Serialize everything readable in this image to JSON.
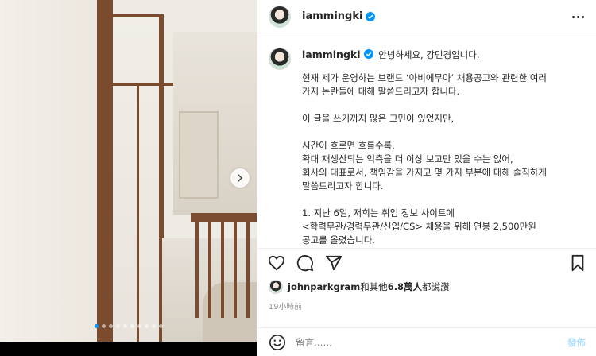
{
  "post": {
    "username": "iammingki",
    "greeting": "안녕하세요, 강민경입니다.",
    "caption_paragraphs": [
      "현재 제가 운영하는 브랜드 ‘아비에무아’ 채용공고와 관련한 여러\n가지 논란들에 대해 말씀드리고자 합니다.",
      "이 글을 쓰기까지 많은 고민이 있었지만,",
      "시간이 흐르면 흐를수록,\n확대 재생산되는 억측을 더 이상 보고만 있을 수는 없어,\n회사의 대표로서, 책임감을 가지고 몇 가지 부분에 대해 솔직하게\n말씀드리고자 합니다.",
      "1. 지난 6일, 저희는 취업 정보 사이트에\n<학력무관/경력무관/신입/CS> 채용을 위해 연봉 2,500만원\n공고를 올렸습니다."
    ],
    "likes": {
      "user": "johnparkgram",
      "middle": "和其他",
      "count": "6.8萬人",
      "suffix": "都說讚"
    },
    "time": "19小時前"
  },
  "comment": {
    "placeholder": "留言……",
    "post_label": "發佈"
  },
  "media": {
    "slide_count": 10,
    "active_slide": 1
  },
  "colors": {
    "verified": "#0095f6",
    "post_button": "#b2dffc",
    "secondary_text": "#8e8e8e"
  },
  "icons": [
    "verified-icon",
    "more-options-icon",
    "heart-icon",
    "comment-icon",
    "share-icon",
    "bookmark-icon",
    "emoji-icon",
    "chevron-right-icon"
  ]
}
